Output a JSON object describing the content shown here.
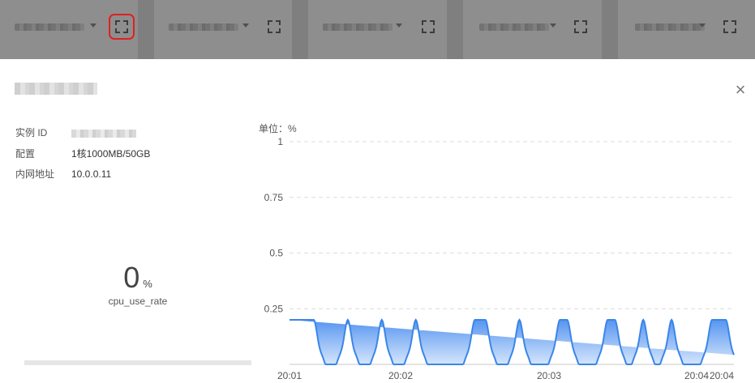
{
  "header": {
    "cards": [
      {
        "name": "card-1",
        "expand_active": true
      },
      {
        "name": "card-2",
        "expand_active": false
      },
      {
        "name": "card-3",
        "expand_active": false
      },
      {
        "name": "card-4",
        "expand_active": false
      },
      {
        "name": "card-5",
        "expand_active": false
      }
    ]
  },
  "modal": {
    "close_icon": "×",
    "info": [
      {
        "label": "实例 ID",
        "value": ""
      },
      {
        "label": "配置",
        "value": "1核1000MB/50GB"
      },
      {
        "label": "内网地址",
        "value": "10.0.0.11"
      }
    ],
    "current_value": "0",
    "current_unit": "%",
    "metric_name": "cpu_use_rate",
    "progress_fraction": 0,
    "accent_color": "#2d7df6"
  },
  "chart_data": {
    "type": "area",
    "unit_label": "单位：%",
    "y_ticks": [
      "1",
      "0.75",
      "0.5",
      "0.25"
    ],
    "ylim": [
      0,
      1
    ],
    "x_ticks": [
      "20:01",
      "20:02",
      "20:03",
      "20:04",
      "20:04"
    ],
    "x": [
      0,
      1,
      2,
      3,
      4,
      5,
      6,
      7,
      8,
      9,
      10,
      11,
      12,
      13,
      14,
      15,
      16,
      17,
      18,
      19,
      20,
      21,
      22,
      23,
      24,
      25,
      26,
      27,
      28,
      29,
      30,
      31,
      32,
      33,
      34,
      35,
      36,
      37,
      38,
      39,
      40,
      41,
      42,
      43,
      44,
      45,
      46,
      47,
      48,
      49,
      50,
      51,
      52,
      53,
      54,
      55,
      56,
      57,
      58,
      59,
      60,
      61,
      62,
      63,
      64,
      65,
      66,
      67,
      68,
      69,
      70,
      71,
      72,
      73,
      74,
      75,
      76,
      77,
      78,
      79,
      80,
      81,
      82,
      83,
      84,
      85,
      86,
      87,
      88,
      89,
      90,
      91,
      92,
      93,
      94,
      95,
      96,
      97,
      98,
      99,
      100,
      101,
      102,
      103,
      104,
      105,
      106,
      107,
      108,
      109,
      110,
      111,
      112,
      113,
      114,
      115,
      116,
      117,
      118,
      119,
      120,
      121,
      122,
      123,
      124,
      125,
      126,
      127,
      128,
      129,
      130,
      131,
      132,
      133,
      134,
      135,
      136,
      137,
      138,
      139,
      140,
      141,
      142,
      143,
      144,
      145,
      146,
      147,
      148,
      149,
      150,
      151,
      152,
      153,
      154,
      155,
      156,
      157,
      158,
      159,
      160,
      161,
      162,
      163,
      164,
      165,
      166,
      167,
      168,
      169,
      170,
      171,
      172,
      173,
      174,
      175,
      176,
      177,
      178,
      179,
      180,
      181,
      182,
      183,
      184,
      185,
      186,
      187,
      188,
      189,
      190,
      191,
      192,
      193,
      194,
      195,
      196,
      197,
      198,
      199,
      200,
      201,
      202,
      203,
      204,
      205,
      206,
      207,
      208,
      209,
      210,
      211,
      212,
      213,
      214,
      215,
      216,
      217,
      218,
      219,
      220,
      221,
      222,
      223,
      224,
      225,
      226,
      227,
      228,
      229,
      230,
      231,
      232,
      233,
      234,
      235,
      236,
      237,
      238,
      239,
      240,
      241,
      242,
      243,
      244,
      245,
      246,
      247,
      248,
      249,
      250,
      251,
      252,
      253,
      254,
      255,
      256,
      257,
      258,
      259,
      260,
      261,
      262,
      263,
      264,
      265,
      266,
      267,
      268,
      269,
      270,
      271,
      272,
      273,
      274,
      275,
      276,
      277,
      278,
      279,
      280,
      281,
      282,
      283,
      284,
      285,
      286,
      287,
      288,
      289,
      290,
      291,
      292,
      293,
      294,
      295,
      296,
      297,
      298,
      299,
      300,
      301,
      302,
      303,
      304,
      305,
      306,
      307,
      308,
      309,
      310,
      311,
      312,
      313,
      314,
      315,
      316,
      317,
      318,
      319,
      320,
      321,
      322,
      323,
      324,
      325,
      326,
      327,
      328,
      329,
      330,
      331,
      332,
      333,
      334,
      335,
      336,
      337,
      338,
      339,
      340,
      341,
      342,
      343,
      344,
      345,
      346,
      347,
      348,
      349,
      350,
      351,
      352,
      353,
      354,
      355,
      356,
      357,
      358,
      359,
      360,
      361,
      362,
      363,
      364,
      365,
      366,
      367,
      368,
      369,
      370,
      371,
      372,
      373,
      374,
      375,
      376,
      377,
      378,
      379,
      380,
      381,
      382,
      383,
      384,
      385,
      386,
      387,
      388,
      389,
      390,
      391,
      392,
      393,
      394,
      395,
      396,
      397,
      398,
      399,
      400,
      401,
      402,
      403,
      404,
      405,
      406,
      407,
      408,
      409,
      410,
      411,
      412,
      413,
      414,
      415,
      416,
      417,
      418,
      419,
      420,
      421,
      422,
      423,
      424,
      425,
      426,
      427,
      428,
      429,
      430,
      431,
      432,
      433,
      434,
      435,
      436,
      437,
      438,
      439,
      440,
      441,
      442,
      443,
      444,
      445,
      446,
      447,
      448,
      449,
      450,
      451,
      452,
      453,
      454,
      455,
      456,
      457,
      458,
      459,
      460,
      461,
      462,
      463,
      464,
      465,
      466,
      467,
      468,
      469,
      470,
      471,
      472,
      473,
      474,
      475,
      476,
      477,
      478,
      479,
      480,
      481,
      482,
      483,
      484,
      485,
      486,
      487,
      488,
      489,
      490,
      491,
      492,
      493,
      494,
      495,
      496,
      497,
      498,
      499,
      500,
      501,
      502,
      503,
      504,
      505,
      506,
      507,
      508,
      509,
      510,
      511,
      512,
      513,
      514,
      515,
      516,
      517,
      518,
      519,
      520,
      521,
      522,
      523,
      524,
      525,
      526,
      527,
      528,
      529,
      530,
      531,
      532,
      533,
      534,
      535,
      536,
      537,
      538,
      539,
      540,
      541,
      542,
      543,
      544,
      545,
      546,
      547,
      548,
      549
    ],
    "series": [
      {
        "color": "#3a86e8",
        "values": [
          0.2,
          0.2,
          0.2,
          0.2,
          0.2,
          0.2,
          0.2,
          0.2,
          0.2,
          0.2,
          0.2,
          0.2,
          0.2,
          0.2,
          0.2,
          0.2,
          0.2,
          0.2,
          0.2,
          0.2,
          0.2,
          0.2,
          0.2,
          0.2,
          0.2,
          0.2,
          0.2,
          0.2,
          0.2,
          0.2,
          0.2,
          0.1943,
          0.18,
          0.1604,
          0.1378,
          0.1149,
          0.0941,
          0.0768,
          0.0632,
          0.0522,
          0.0428,
          0.0334,
          0.0233,
          0.0124,
          0.0024,
          0,
          0,
          0,
          0,
          0,
          0,
          0,
          0,
          0,
          0,
          0,
          0,
          0,
          0.0024,
          0.0124,
          0.0233,
          0.0334,
          0.0428,
          0.0522,
          0.0632,
          0.0768,
          0.0941,
          0.1149,
          0.1378,
          0.1604,
          0.18,
          0.1943,
          0.2,
          0.1943,
          0.18,
          0.1604,
          0.1378,
          0.1149,
          0.0941,
          0.0768,
          0.0632,
          0.0522,
          0.0428,
          0.0334,
          0.0233,
          0.0124,
          0.0024,
          0,
          0,
          0,
          0,
          0,
          0,
          0,
          0,
          0,
          0,
          0,
          0,
          0,
          0.0024,
          0.0124,
          0.0233,
          0.0334,
          0.0428,
          0.0522,
          0.0632,
          0.0768,
          0.0941,
          0.1149,
          0.1378,
          0.1604,
          0.18,
          0.1943,
          0.2,
          0.1943,
          0.18,
          0.1604,
          0.1378,
          0.1149,
          0.0941,
          0.0768,
          0.0632,
          0.0522,
          0.0428,
          0.0334,
          0.0233,
          0.0124,
          0.0024,
          0,
          0,
          0,
          0,
          0,
          0,
          0,
          0,
          0,
          0,
          0,
          0,
          0,
          0.0024,
          0.0124,
          0.0233,
          0.0334,
          0.0428,
          0.0522,
          0.0632,
          0.0768,
          0.0941,
          0.1149,
          0.1378,
          0.1604,
          0.18,
          0.1943,
          0.2,
          0.1943,
          0.18,
          0.1604,
          0.1378,
          0.1149,
          0.0941,
          0.0768,
          0.0632,
          0.0522,
          0.0428,
          0.0334,
          0.0233,
          0.0124,
          0.0024,
          0,
          0,
          0,
          0,
          0,
          0,
          0,
          0,
          0,
          0,
          0,
          0,
          0,
          0,
          0,
          0,
          0,
          0,
          0,
          0,
          0,
          0,
          0,
          0,
          0,
          0,
          0,
          0,
          0,
          0,
          0,
          0,
          0,
          0,
          0,
          0,
          0,
          0,
          0,
          0,
          0,
          0,
          0,
          0,
          0.0024,
          0.0124,
          0.0233,
          0.0334,
          0.0428,
          0.0522,
          0.0632,
          0.0768,
          0.0941,
          0.1149,
          0.1378,
          0.1604,
          0.18,
          0.1943,
          0.2,
          0.2,
          0.2,
          0.2,
          0.2,
          0.2,
          0.2,
          0.2,
          0.2,
          0.2,
          0.2,
          0.2,
          0.2,
          0.2,
          0.1943,
          0.18,
          0.1604,
          0.1378,
          0.1149,
          0.0941,
          0.0768,
          0.0632,
          0.0522,
          0.0428,
          0.0334,
          0.0233,
          0.0124,
          0.0024,
          0,
          0,
          0,
          0,
          0,
          0,
          0,
          0,
          0,
          0,
          0,
          0,
          0,
          0.0024,
          0.0124,
          0.0233,
          0.0334,
          0.0428,
          0.0522,
          0.0632,
          0.0768,
          0.0941,
          0.1149,
          0.1378,
          0.1604,
          0.18,
          0.1943,
          0.2,
          0.1943,
          0.18,
          0.1604,
          0.1378,
          0.1149,
          0.0941,
          0.0768,
          0.0632,
          0.0522,
          0.0428,
          0.0334,
          0.0233,
          0.0124,
          0.0024,
          0,
          0,
          0,
          0,
          0,
          0,
          0,
          0,
          0,
          0,
          0,
          0,
          0,
          0,
          0,
          0,
          0,
          0,
          0,
          0,
          0,
          0.0024,
          0.0124,
          0.0233,
          0.0334,
          0.0428,
          0.0522,
          0.0632,
          0.0768,
          0.0941,
          0.1149,
          0.1378,
          0.1604,
          0.18,
          0.1943,
          0.2,
          0.2,
          0.2,
          0.2,
          0.2,
          0.2,
          0.2,
          0.2,
          0.2,
          0.2,
          0.1943,
          0.18,
          0.1604,
          0.1378,
          0.1149,
          0.0941,
          0.0768,
          0.0632,
          0.0522,
          0.0428,
          0.0334,
          0.0233,
          0.0124,
          0.0024,
          0,
          0,
          0,
          0,
          0,
          0,
          0,
          0,
          0,
          0,
          0,
          0,
          0,
          0,
          0,
          0,
          0,
          0,
          0,
          0,
          0,
          0.0024,
          0.0124,
          0.0233,
          0.0334,
          0.0428,
          0.0522,
          0.0632,
          0.0768,
          0.0941,
          0.1149,
          0.1378,
          0.1604,
          0.18,
          0.1943,
          0.2,
          0.2,
          0.2,
          0.2,
          0.2,
          0.2,
          0.2,
          0.2,
          0.2,
          0.2,
          0.1943,
          0.18,
          0.1604,
          0.1378,
          0.1149,
          0.0941,
          0.0768,
          0.0632,
          0.0522,
          0.0428,
          0.0334,
          0.0233,
          0.0124,
          0.0024,
          0,
          0,
          0,
          0,
          0,
          0,
          0.0024,
          0.0124,
          0.0233,
          0.0334,
          0.0428,
          0.0522,
          0.0632,
          0.0768,
          0.0941,
          0.1149,
          0.1378,
          0.1604,
          0.18,
          0.1943,
          0.2,
          0.1943,
          0.18,
          0.1604,
          0.1378,
          0.1149,
          0.0941,
          0.0768,
          0.0632,
          0.0522,
          0.0428,
          0.0334,
          0.0233,
          0.0124,
          0.0024,
          0,
          0,
          0,
          0,
          0,
          0,
          0.0024,
          0.0124,
          0.0233,
          0.0334,
          0.0428,
          0.0522,
          0.0632,
          0.0768,
          0.0941,
          0.1149,
          0.1378,
          0.1604,
          0.18,
          0.1943,
          0.2,
          0.1943,
          0.18,
          0.1604,
          0.1378,
          0.1149,
          0.0941,
          0.0768,
          0.0632,
          0.0522,
          0.0428,
          0.0334,
          0.0233,
          0.0124,
          0.0024,
          0,
          0,
          0,
          0,
          0,
          0,
          0,
          0,
          0,
          0,
          0,
          0,
          0,
          0,
          0,
          0,
          0,
          0,
          0,
          0,
          0,
          0.0024,
          0.0124,
          0.0233,
          0.0334,
          0.0428,
          0.0522,
          0.0632,
          0.0768,
          0.0941,
          0.1149,
          0.1378,
          0.1604,
          0.18,
          0.1943,
          0.2,
          0.2,
          0.2,
          0.2,
          0.2,
          0.2,
          0.2,
          0.2,
          0.2,
          0.2,
          0.2,
          0.2,
          0.2,
          0.2,
          0.2,
          0.2,
          0.2,
          0.2,
          0.1943,
          0.18,
          0.1604,
          0.1378,
          0.1149,
          0.0941,
          0.0768,
          0.0632,
          0.0522,
          0.0428,
          0.0334,
          0.0233,
          0.0124,
          0.0024,
          0,
          0,
          0,
          0,
          0,
          0,
          0,
          0,
          0,
          0,
          0,
          0.0024,
          0.0124,
          0.0233,
          0.0334,
          0.0428,
          0.0522,
          0.0632,
          0.0768,
          0.0941,
          0.1149,
          0.1378,
          0.1604,
          0.18,
          0.1943,
          0.2,
          0.1943,
          0.18,
          0.1604,
          0.1378,
          0.1149,
          0.0941,
          0.0768,
          0.0632,
          0.0522,
          0.0428,
          0.0334,
          0.0233,
          0.0124,
          0.0024,
          0,
          0,
          0,
          0,
          0,
          0,
          0,
          0,
          0,
          0,
          0,
          0,
          0,
          0,
          0,
          0,
          0,
          0
        ]
      }
    ],
    "grid": "horizontal-dashed"
  }
}
